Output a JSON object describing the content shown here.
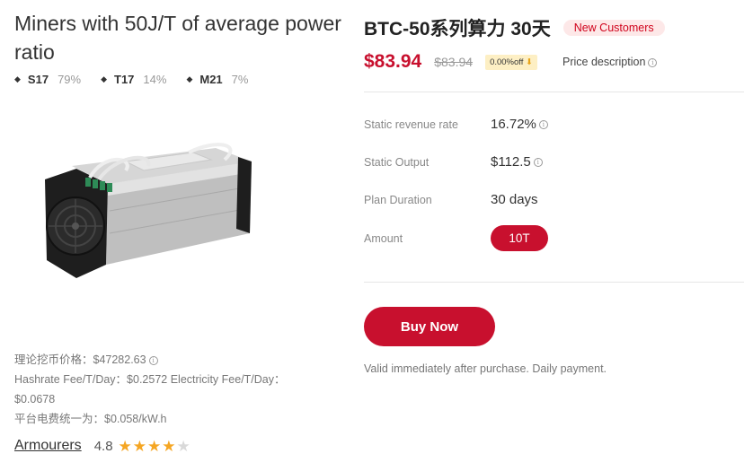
{
  "left": {
    "title": "Miners with 50J/T of average power ratio",
    "mix": [
      {
        "model": "S17",
        "pct": "79%"
      },
      {
        "model": "T17",
        "pct": "14%"
      },
      {
        "model": "M21",
        "pct": "7%"
      }
    ],
    "fees": {
      "line1": "理论挖币价格：$47282.63",
      "line2": "Hashrate Fee/T/Day：$0.2572   Electricity Fee/T/Day：$0.0678",
      "line3": "平台电费统一为：$0.058/kW.h"
    },
    "brand": "Armourers",
    "rating": "4.8",
    "stars_filled": 4,
    "stars_total": 5
  },
  "right": {
    "title": "BTC-50系列算力 30天",
    "badge": "New Customers",
    "price": "$83.94",
    "old_price": "$83.94",
    "off_badge": "0.00%off",
    "price_desc": "Price description",
    "specs": {
      "static_revenue_rate": {
        "label": "Static revenue rate",
        "value": "16.72%"
      },
      "static_output": {
        "label": "Static Output",
        "value": "$112.5"
      },
      "plan_duration": {
        "label": "Plan Duration",
        "value": "30 days"
      },
      "amount": {
        "label": "Amount",
        "value": "10T"
      }
    },
    "buy_label": "Buy Now",
    "valid_note": "Valid immediately after purchase. Daily payment."
  },
  "colors": {
    "accent": "#c8102e",
    "star": "#f5a623",
    "badge_bg": "#fde8e8",
    "off_bg": "#fdefc4"
  },
  "icons": [
    "info-icon",
    "star-icon",
    "diamond-bullet-icon",
    "down-arrow-icon"
  ]
}
